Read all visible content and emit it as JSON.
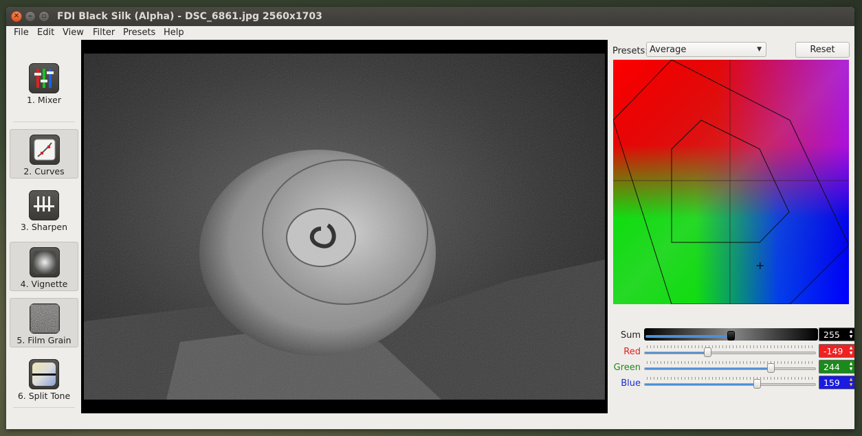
{
  "window": {
    "title": "FDI Black Silk (Alpha) - DSC_6861.jpg 2560x1703"
  },
  "menu": [
    "File",
    "Edit",
    "View",
    "Filter",
    "Presets",
    "Help"
  ],
  "tools": [
    {
      "label": "1. Mixer",
      "icon": "mixer-icon",
      "selected": false
    },
    {
      "label": "2. Curves",
      "icon": "curves-icon",
      "selected": true
    },
    {
      "label": "3. Sharpen",
      "icon": "sharpen-icon",
      "selected": false
    },
    {
      "label": "4. Vignette",
      "icon": "vignette-icon",
      "selected": true
    },
    {
      "label": "5. Film Grain",
      "icon": "film-grain-icon",
      "selected": true
    },
    {
      "label": "6. Split Tone",
      "icon": "split-tone-icon",
      "selected": false
    }
  ],
  "viewer": {
    "image_subject": "snail-shell-photo"
  },
  "presets": {
    "label": "Presets:",
    "value": "Average",
    "reset_label": "Reset"
  },
  "sliders": [
    {
      "label": "Sum",
      "value": "255",
      "level": 0.5,
      "label_color": "#222222",
      "box_color": "#000000"
    },
    {
      "label": "Red",
      "value": "-149",
      "level": 0.36,
      "label_color": "#e02020",
      "box_color": "#ee2222"
    },
    {
      "label": "Green",
      "value": "244",
      "level": 0.73,
      "label_color": "#1a8a1a",
      "box_color": "#1a8a1a"
    },
    {
      "label": "Blue",
      "value": "159",
      "level": 0.65,
      "label_color": "#1a2ad0",
      "box_color": "#1a1ae0"
    }
  ],
  "colors": {
    "accent": "#4a90d9",
    "titlebar": "#3c3b37",
    "window_bg": "#efedea"
  }
}
